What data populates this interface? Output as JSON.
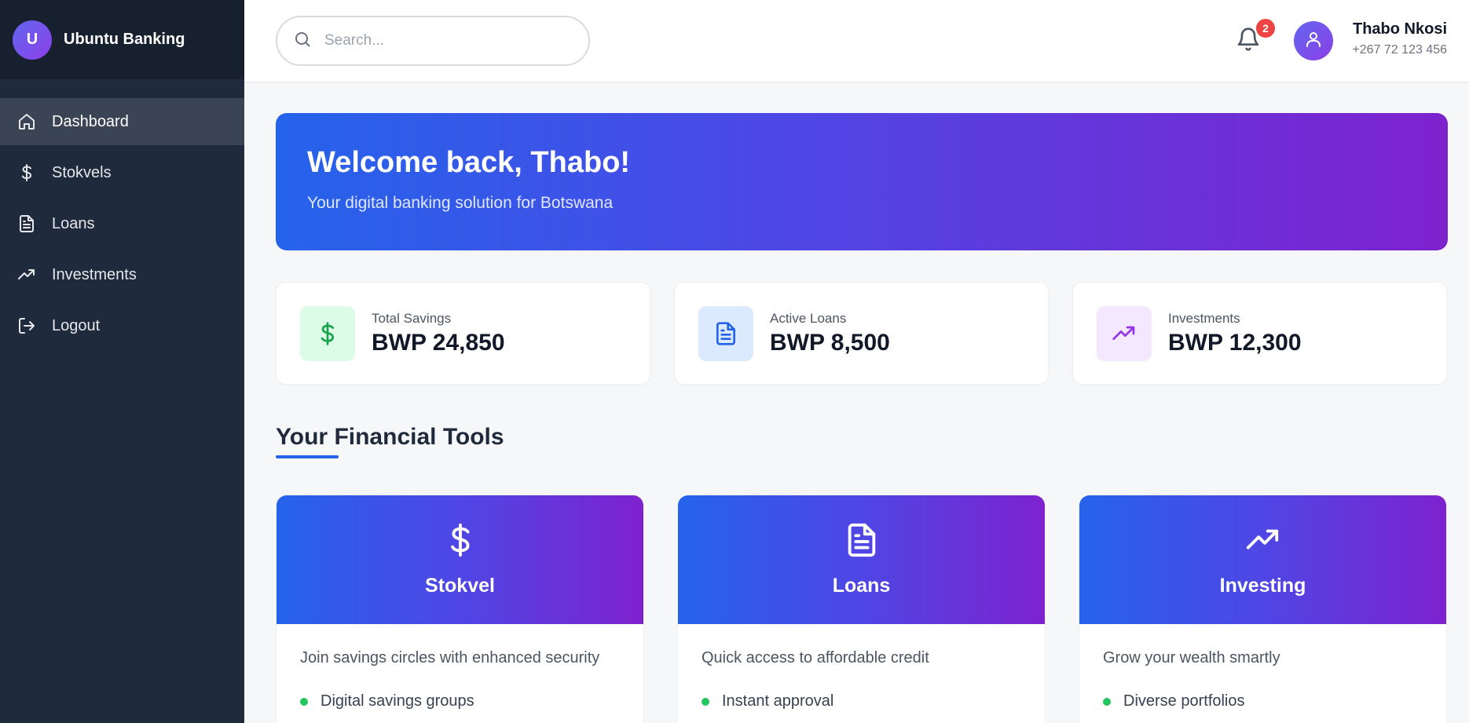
{
  "brand": {
    "initial": "U",
    "name": "Ubuntu Banking"
  },
  "nav": [
    {
      "label": "Dashboard",
      "icon": "home-icon",
      "active": true
    },
    {
      "label": "Stokvels",
      "icon": "dollar-icon"
    },
    {
      "label": "Loans",
      "icon": "document-icon"
    },
    {
      "label": "Investments",
      "icon": "trending-up-icon"
    },
    {
      "label": "Logout",
      "icon": "logout-icon"
    }
  ],
  "header": {
    "search_placeholder": "Search...",
    "notification_count": "2",
    "user_name": "Thabo Nkosi",
    "user_phone": "+267 72 123 456"
  },
  "hero": {
    "title": "Welcome back, Thabo!",
    "subtitle": "Your digital banking solution for Botswana"
  },
  "stats": [
    {
      "label": "Total Savings",
      "value": "BWP 24,850",
      "icon": "dollar-icon",
      "color": "#16a34a",
      "bg": "#dcfce7"
    },
    {
      "label": "Active Loans",
      "value": "BWP 8,500",
      "icon": "document-icon",
      "color": "#2563eb",
      "bg": "#dbeafe"
    },
    {
      "label": "Investments",
      "value": "BWP 12,300",
      "icon": "trending-up-icon",
      "color": "#9333ea",
      "bg": "#f3e8ff"
    }
  ],
  "section_title": "Your Financial Tools",
  "tools": [
    {
      "title": "Stokvel",
      "icon": "dollar-icon",
      "description": "Join savings circles with enhanced security",
      "feature": "Digital savings groups"
    },
    {
      "title": "Loans",
      "icon": "document-icon",
      "description": "Quick access to affordable credit",
      "feature": "Instant approval"
    },
    {
      "title": "Investing",
      "icon": "trending-up-icon",
      "description": "Grow your wealth smartly",
      "feature": "Diverse portfolios"
    }
  ],
  "colors": {
    "sidebar": "#1f2a3c",
    "accent_start": "#2563eb",
    "accent_end": "#7e22ce",
    "badge": "#ef4444",
    "feature_dot": "#22c55e"
  }
}
